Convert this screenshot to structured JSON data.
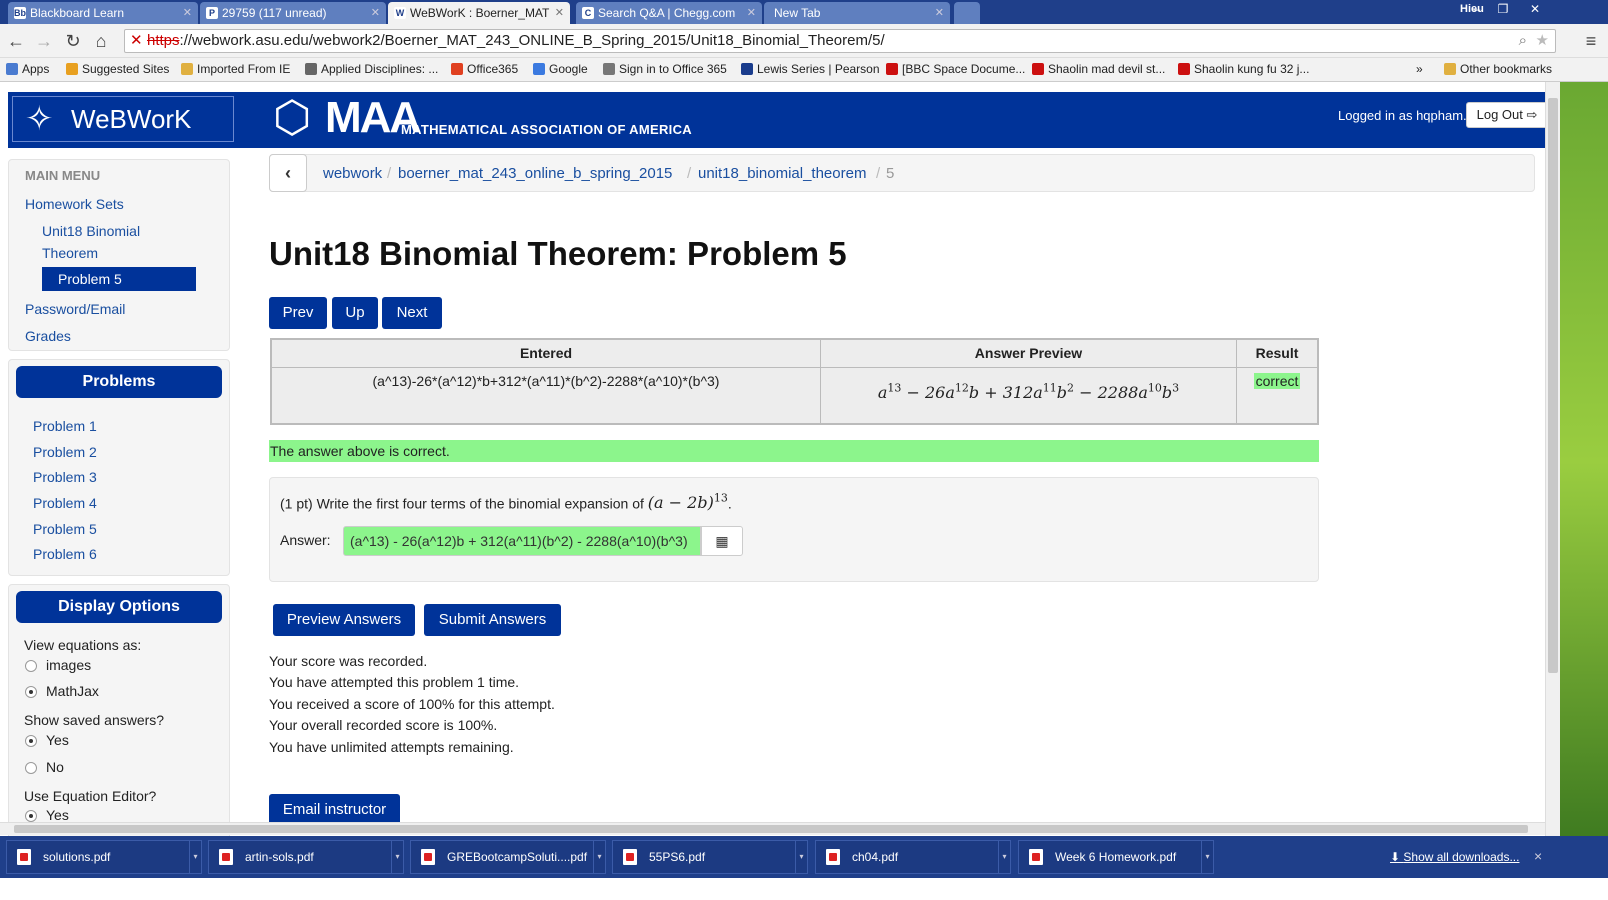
{
  "browser": {
    "tabs": [
      {
        "label": "Blackboard Learn",
        "icon": "Bb"
      },
      {
        "label": "29759 (117 unread)",
        "icon": "P"
      },
      {
        "label": "WeBWorK : Boerner_MAT",
        "icon": "W"
      },
      {
        "label": "Search Q&A | Chegg.com",
        "icon": "C"
      },
      {
        "label": "New Tab",
        "icon": ""
      }
    ],
    "window_user": "Hieu",
    "url_scheme": "https",
    "url_rest": "://webwork.asu.edu/webwork2/Boerner_MAT_243_ONLINE_B_Spring_2015/Unit18_Binomial_Theorem/5/",
    "bookmarks": [
      {
        "label": "Apps",
        "color": "#4a7bd0"
      },
      {
        "label": "Suggested Sites",
        "color": "#e8a020"
      },
      {
        "label": "Imported From IE",
        "color": "#e0b040"
      },
      {
        "label": "Applied Disciplines: ...",
        "color": "#666666"
      },
      {
        "label": "Office365",
        "color": "#e04020"
      },
      {
        "label": "Google",
        "color": "#3b7ae0"
      },
      {
        "label": "Sign in to Office 365",
        "color": "#777777"
      },
      {
        "label": "Lewis Series | Pearson",
        "color": "#1a3c8c"
      },
      {
        "label": "[BBC Space Docume...",
        "color": "#cc1010"
      },
      {
        "label": "Shaolin mad devil st...",
        "color": "#cc1010"
      },
      {
        "label": "Shaolin kung fu 32 j...",
        "color": "#cc1010"
      }
    ],
    "bookmark_overflow": "»",
    "other_bookmarks": "Other bookmarks"
  },
  "header": {
    "webwork_logo": "WeBWorK",
    "maa_big": "MAA",
    "maa_small": "MATHEMATICAL ASSOCIATION OF AMERICA",
    "logged_in": "Logged in as hqpham.",
    "logout": "Log Out ⇨"
  },
  "sidebar": {
    "menu_title": "MAIN MENU",
    "homework_sets": "Homework Sets",
    "set_name_line1": "Unit18 Binomial",
    "set_name_line2": "Theorem",
    "active_problem": "Problem 5",
    "password_email": "Password/Email",
    "grades": "Grades",
    "problems_title": "Problems",
    "problems": [
      "Problem 1",
      "Problem 2",
      "Problem 3",
      "Problem 4",
      "Problem 5",
      "Problem 6"
    ],
    "display_title": "Display Options",
    "view_equations_label": "View equations as:",
    "opt_images": "images",
    "opt_mathjax": "MathJax",
    "show_saved_label": "Show saved answers?",
    "opt_yes": "Yes",
    "opt_no": "No",
    "equation_editor_label": "Use Equation Editor?",
    "opt_yes2": "Yes"
  },
  "breadcrumb": {
    "back": "‹",
    "items": [
      "webwork",
      "boerner_mat_243_online_b_spring_2015",
      "unit18_binomial_theorem"
    ],
    "current": "5",
    "sep": "/"
  },
  "main": {
    "title": "Unit18 Binomial Theorem: Problem 5",
    "nav": {
      "prev": "Prev",
      "up": "Up",
      "next": "Next"
    },
    "results": {
      "headers": [
        "Entered",
        "Answer Preview",
        "Result"
      ],
      "entered": "(a^13)-26*(a^12)*b+312*(a^11)*(b^2)-2288*(a^10)*(b^3)",
      "result": "correct"
    },
    "correct_msg": "The answer above is correct.",
    "problem_text": "(1 pt) Write the first four terms of the binomial expansion of",
    "answer_label": "Answer:",
    "answer_value": "(a^13) - 26(a^12)b + 312(a^11)(b^2) - 2288(a^10)(b^3)",
    "preview_btn": "Preview Answers",
    "submit_btn": "Submit Answers",
    "score_lines": [
      "Your score was recorded.",
      "You have attempted this problem 1 time.",
      "You received a score of 100% for this attempt.",
      "Your overall recorded score is 100%.",
      "You have unlimited attempts remaining."
    ],
    "email_btn": "Email instructor"
  },
  "downloads": {
    "items": [
      "solutions.pdf",
      "artin-sols.pdf",
      "GREBootcampSoluti....pdf",
      "55PS6.pdf",
      "ch04.pdf",
      "Week 6 Homework.pdf"
    ],
    "show_all": "Show all downloads...",
    "close": "×"
  },
  "colors": {
    "primary": "#003399",
    "success": "#8cf58c",
    "link": "#1a4fa0"
  }
}
